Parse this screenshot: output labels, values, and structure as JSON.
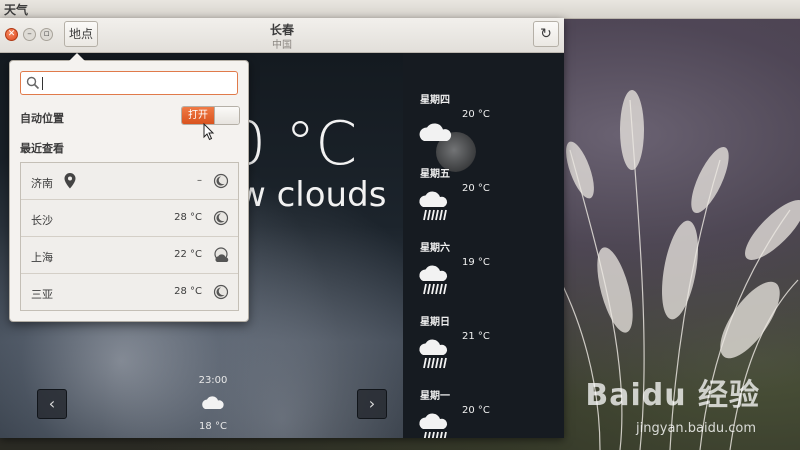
{
  "top_panel": {
    "app_name": "天气"
  },
  "window": {
    "places_button": "地点",
    "title": "长春",
    "subtitle": "中国",
    "refresh_icon": "refresh-icon"
  },
  "current": {
    "temp_fragment": "0 °C",
    "condition_fragment": "w clouds"
  },
  "hourly": {
    "time": "23:00",
    "temp": "18 °C",
    "icon": "few-clouds-icon",
    "prev_icon": "chevron-left-icon",
    "next_icon": "chevron-right-icon"
  },
  "forecast": [
    {
      "day": "星期四",
      "temp": "20 °C",
      "icon": "cloud-icon"
    },
    {
      "day": "星期五",
      "temp": "20 °C",
      "icon": "rain-icon"
    },
    {
      "day": "星期六",
      "temp": "19 °C",
      "icon": "rain-icon"
    },
    {
      "day": "星期日",
      "temp": "21 °C",
      "icon": "rain-icon"
    },
    {
      "day": "星期一",
      "temp": "20 °C",
      "icon": "rain-icon"
    }
  ],
  "popover": {
    "search": {
      "value": "",
      "placeholder": ""
    },
    "auto_location_label": "自动位置",
    "auto_location_toggle": "打开",
    "recent_label": "最近查看",
    "recent": [
      {
        "city": "济南",
        "temp": "–",
        "icon": "clear-night-icon",
        "current_location": true
      },
      {
        "city": "长沙",
        "temp": "28 °C",
        "icon": "clear-night-icon",
        "current_location": false
      },
      {
        "city": "上海",
        "temp": "22 °C",
        "icon": "few-clouds-night-icon",
        "current_location": false
      },
      {
        "city": "三亚",
        "temp": "28 °C",
        "icon": "clear-night-icon",
        "current_location": false
      }
    ]
  },
  "watermark": {
    "brand": "Baidu 经验",
    "url": "jingyan.baidu.com"
  }
}
